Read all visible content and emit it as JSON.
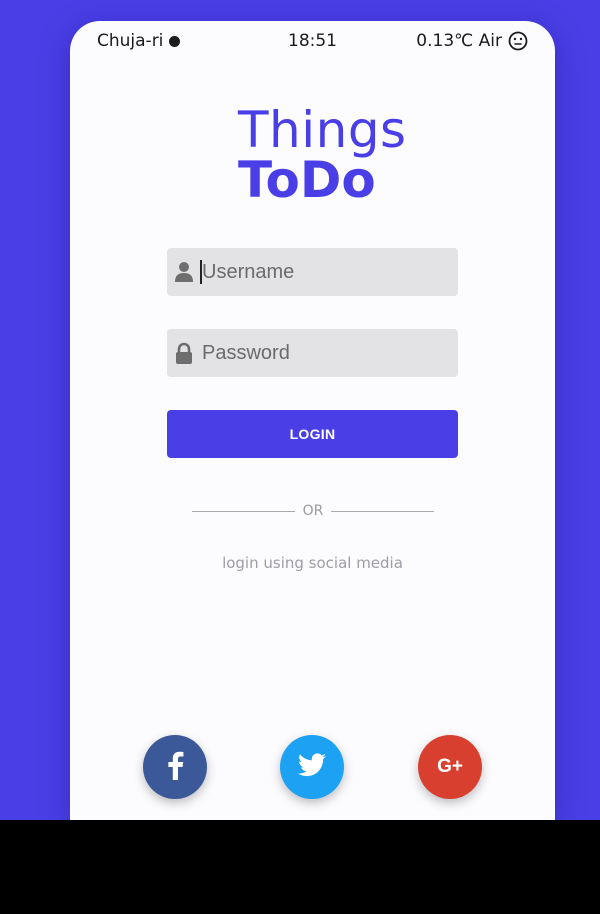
{
  "status_bar": {
    "location": "Chuja-ri",
    "time": "18:51",
    "weather": "0.13℃ Air",
    "air_icon": "neutral-face-icon"
  },
  "app": {
    "title_line1": "Things",
    "title_line2": "ToDo",
    "accent_color": "#4a3fe6"
  },
  "form": {
    "username": {
      "value": "",
      "placeholder": "Username",
      "icon": "user-icon"
    },
    "password": {
      "value": "",
      "placeholder": "Password",
      "icon": "lock-icon"
    },
    "login_label": "LOGIN"
  },
  "divider_label": "OR",
  "social": {
    "caption": "login using social media",
    "buttons": [
      {
        "name": "facebook",
        "icon": "facebook-icon",
        "color": "#3b5998"
      },
      {
        "name": "twitter",
        "icon": "twitter-icon",
        "color": "#1da1f2"
      },
      {
        "name": "google-plus",
        "icon": "google-plus-icon",
        "label": "G+",
        "color": "#d93f2e"
      }
    ]
  }
}
